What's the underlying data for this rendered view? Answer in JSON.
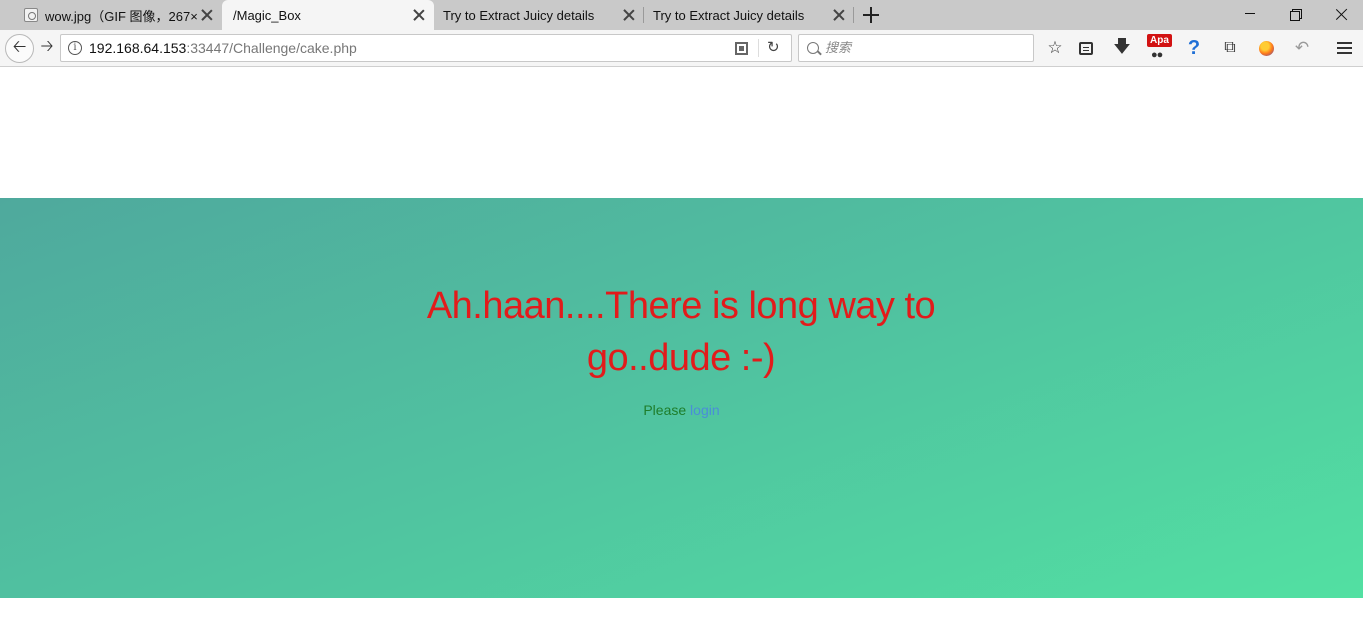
{
  "browser": {
    "tabs": [
      {
        "label": "wow.jpg（GIF 图像，267×"
      },
      {
        "label": "/Magic_Box"
      },
      {
        "label": "Try to Extract Juicy details"
      },
      {
        "label": "Try to Extract Juicy details"
      }
    ],
    "url_host": "192.168.64.153",
    "url_rest": ":33447/Challenge/cake.php",
    "search_placeholder": "搜索",
    "apa_badge": "Apa"
  },
  "page": {
    "headline": "Ah.haan....There is long way to go..dude :-)",
    "please_text": "Please",
    "login_link": "login"
  },
  "colors": {
    "headline": "#e21b1b",
    "please": "#1e7d2a",
    "link": "#4a8ed8",
    "hero_start": "#4fa99d",
    "hero_end": "#52e0a2"
  }
}
